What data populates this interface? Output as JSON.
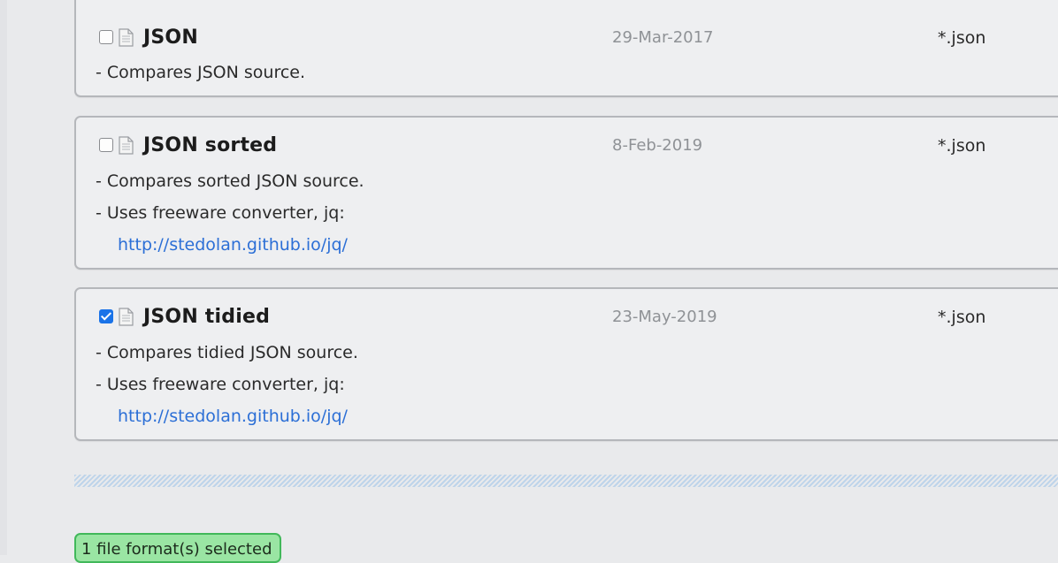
{
  "formats": [
    {
      "title": "JSON",
      "date": "29-Mar-2017",
      "extension": "*.json",
      "checked": false,
      "lines": [
        "- Compares JSON source."
      ],
      "link": null
    },
    {
      "title": "JSON sorted",
      "date": "8-Feb-2019",
      "extension": "*.json",
      "checked": false,
      "lines": [
        "- Compares sorted JSON source.",
        "- Uses freeware converter, jq:"
      ],
      "link": "http://stedolan.github.io/jq/"
    },
    {
      "title": "JSON tidied",
      "date": "23-May-2019",
      "extension": "*.json",
      "checked": true,
      "lines": [
        "- Compares tidied JSON source.",
        "- Uses freeware converter, jq:"
      ],
      "link": "http://stedolan.github.io/jq/"
    }
  ],
  "status": {
    "selected_text": "1 file format(s) selected"
  },
  "icons": {
    "document": "document-icon",
    "checkbox": "checkbox-icon"
  },
  "colors": {
    "accent": "#1a73e8",
    "link": "#2c6fd6",
    "badge_bg": "#9ae5a3",
    "badge_border": "#41b85a"
  }
}
